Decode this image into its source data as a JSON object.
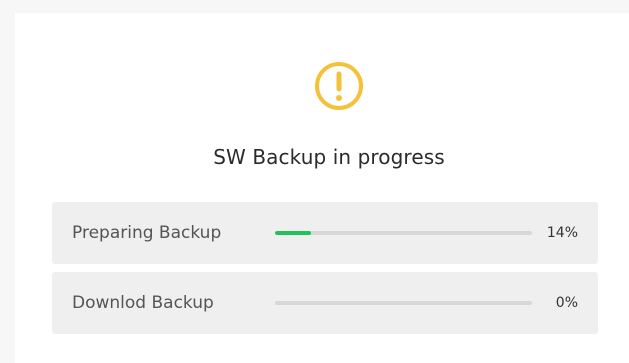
{
  "dialog": {
    "icon": "warning-circle-icon",
    "title": "SW Backup in progress",
    "colors": {
      "warning": "#f4c23a",
      "progress_fill": "#22c25a",
      "track": "#d7d7d7"
    }
  },
  "tasks": [
    {
      "label": "Preparing Backup",
      "progress": 0.14,
      "percent_text": "14%"
    },
    {
      "label": "Downlod Backup",
      "progress": 0,
      "percent_text": "0%"
    }
  ]
}
